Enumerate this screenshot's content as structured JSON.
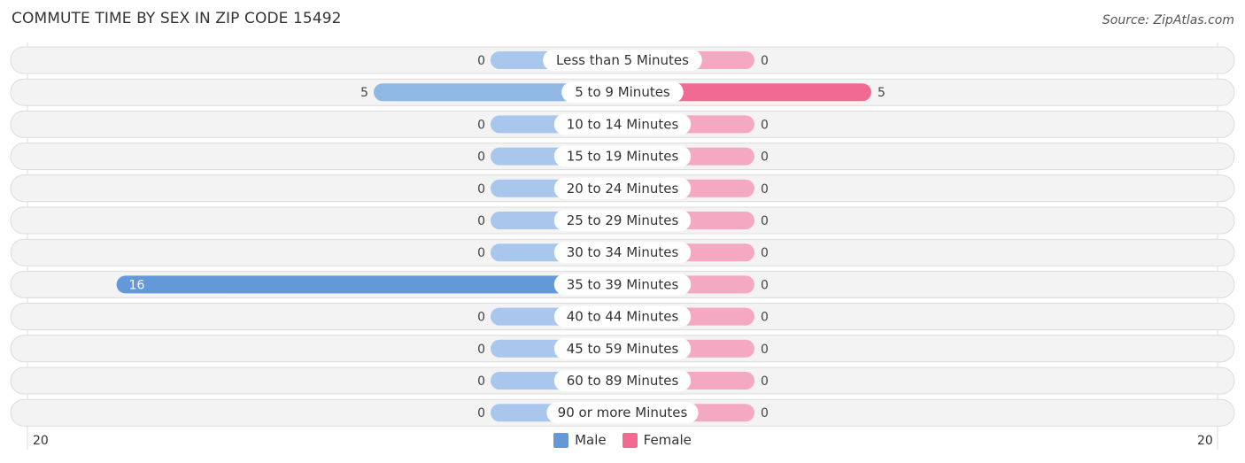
{
  "header": {
    "title": "COMMUTE TIME BY SEX IN ZIP CODE 15492",
    "source": "Source: ZipAtlas.com"
  },
  "colors": {
    "male_strong": "#6399d9",
    "male_light": "#a9c7ec",
    "male_mid": "#8fb8e5",
    "female_strong": "#f06a94",
    "female_light": "#f5a8c1",
    "track": "#f2f2f2"
  },
  "chart_data": {
    "type": "bar",
    "orientation": "horizontal-diverging",
    "title": "COMMUTE TIME BY SEX IN ZIP CODE 15492",
    "categories": [
      "Less than 5 Minutes",
      "5 to 9 Minutes",
      "10 to 14 Minutes",
      "15 to 19 Minutes",
      "20 to 24 Minutes",
      "25 to 29 Minutes",
      "30 to 34 Minutes",
      "35 to 39 Minutes",
      "40 to 44 Minutes",
      "45 to 59 Minutes",
      "60 to 89 Minutes",
      "90 or more Minutes"
    ],
    "series": [
      {
        "name": "Male",
        "values": [
          0,
          5,
          0,
          0,
          0,
          0,
          0,
          16,
          0,
          0,
          0,
          0
        ]
      },
      {
        "name": "Female",
        "values": [
          0,
          5,
          0,
          0,
          0,
          0,
          0,
          0,
          0,
          0,
          0,
          0
        ]
      }
    ],
    "axis": {
      "left_label": "20",
      "right_label": "20",
      "range": [
        -20,
        20
      ]
    },
    "legend": {
      "position": "bottom-center",
      "items": [
        "Male",
        "Female"
      ]
    }
  }
}
